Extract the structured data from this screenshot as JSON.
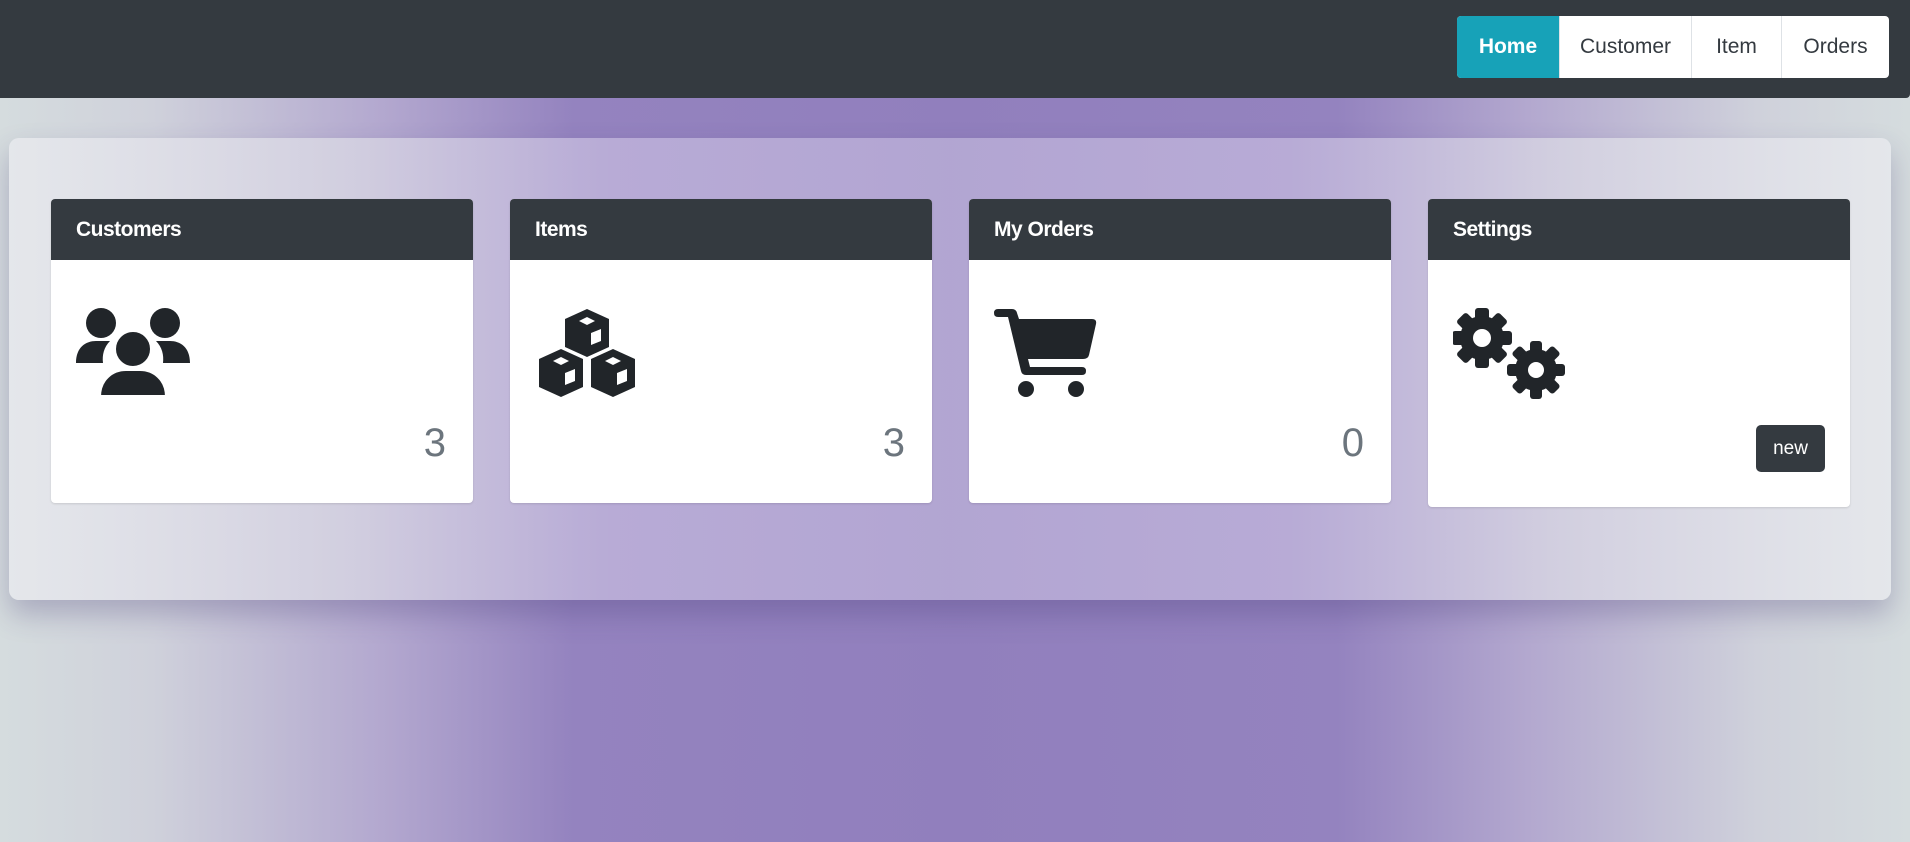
{
  "nav": {
    "items": [
      {
        "label": "Home",
        "active": true
      },
      {
        "label": "Customer",
        "active": false
      },
      {
        "label": "Item",
        "active": false
      },
      {
        "label": "Orders",
        "active": false
      }
    ]
  },
  "cards": [
    {
      "title": "Customers",
      "icon": "users-icon",
      "count": "3"
    },
    {
      "title": "Items",
      "icon": "cubes-icon",
      "count": "3"
    },
    {
      "title": "My Orders",
      "icon": "shopping-cart-icon",
      "count": "0"
    },
    {
      "title": "Settings",
      "icon": "cogs-icon",
      "button_label": "new"
    }
  ],
  "colors": {
    "topbar": "#343a40",
    "active_tab": "#17a2b8",
    "card_header": "#343a40",
    "background_accent": "#917fbd"
  }
}
